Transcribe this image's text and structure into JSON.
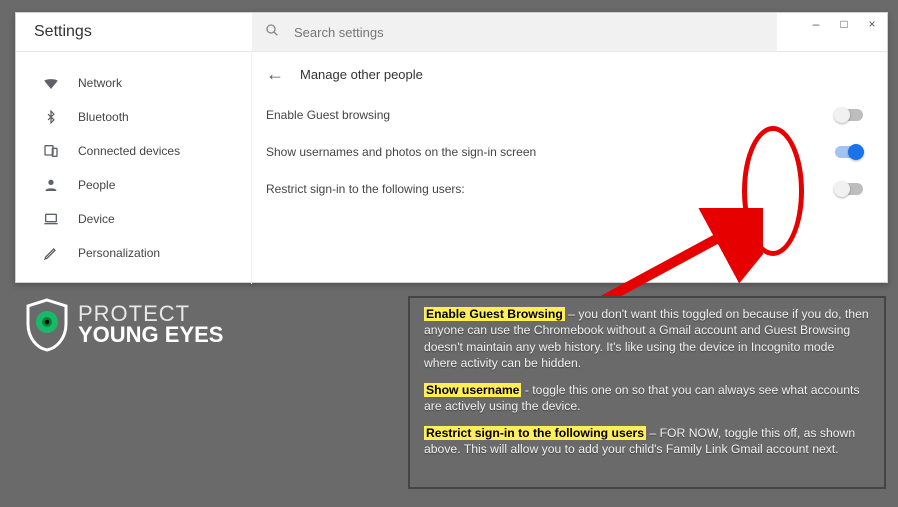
{
  "window": {
    "min_label": "–",
    "max_label": "□",
    "close_label": "×"
  },
  "header": {
    "title": "Settings",
    "search_placeholder": "Search settings"
  },
  "sidebar": {
    "items": [
      {
        "label": "Network",
        "icon": "wifi"
      },
      {
        "label": "Bluetooth",
        "icon": "bluetooth"
      },
      {
        "label": "Connected devices",
        "icon": "devices"
      },
      {
        "label": "People",
        "icon": "person"
      },
      {
        "label": "Device",
        "icon": "laptop"
      },
      {
        "label": "Personalization",
        "icon": "pen"
      }
    ]
  },
  "content": {
    "section_title": "Manage other people",
    "rows": [
      {
        "label": "Enable Guest browsing",
        "on": false
      },
      {
        "label": "Show usernames and photos on the sign-in screen",
        "on": true
      },
      {
        "label": "Restrict sign-in to the following users:",
        "on": false
      }
    ]
  },
  "logo": {
    "line1": "PROTECT",
    "line2": "YOUNG EYES"
  },
  "info": {
    "p1_hl": "Enable Guest Browsing",
    "p1": " – you don't want this toggled on because if you do, then anyone can use the Chromebook without a Gmail account and Guest Browsing doesn't maintain any web history. It's like using the device in Incognito mode where activity can be hidden.",
    "p2_hl": "Show username",
    "p2": " - toggle this one on so that you can always see what accounts are actively using the device.",
    "p3_hl": "Restrict sign-in to the following users",
    "p3": " – FOR NOW, toggle this off, as shown above. This will allow you to add your child's Family Link Gmail account next."
  }
}
